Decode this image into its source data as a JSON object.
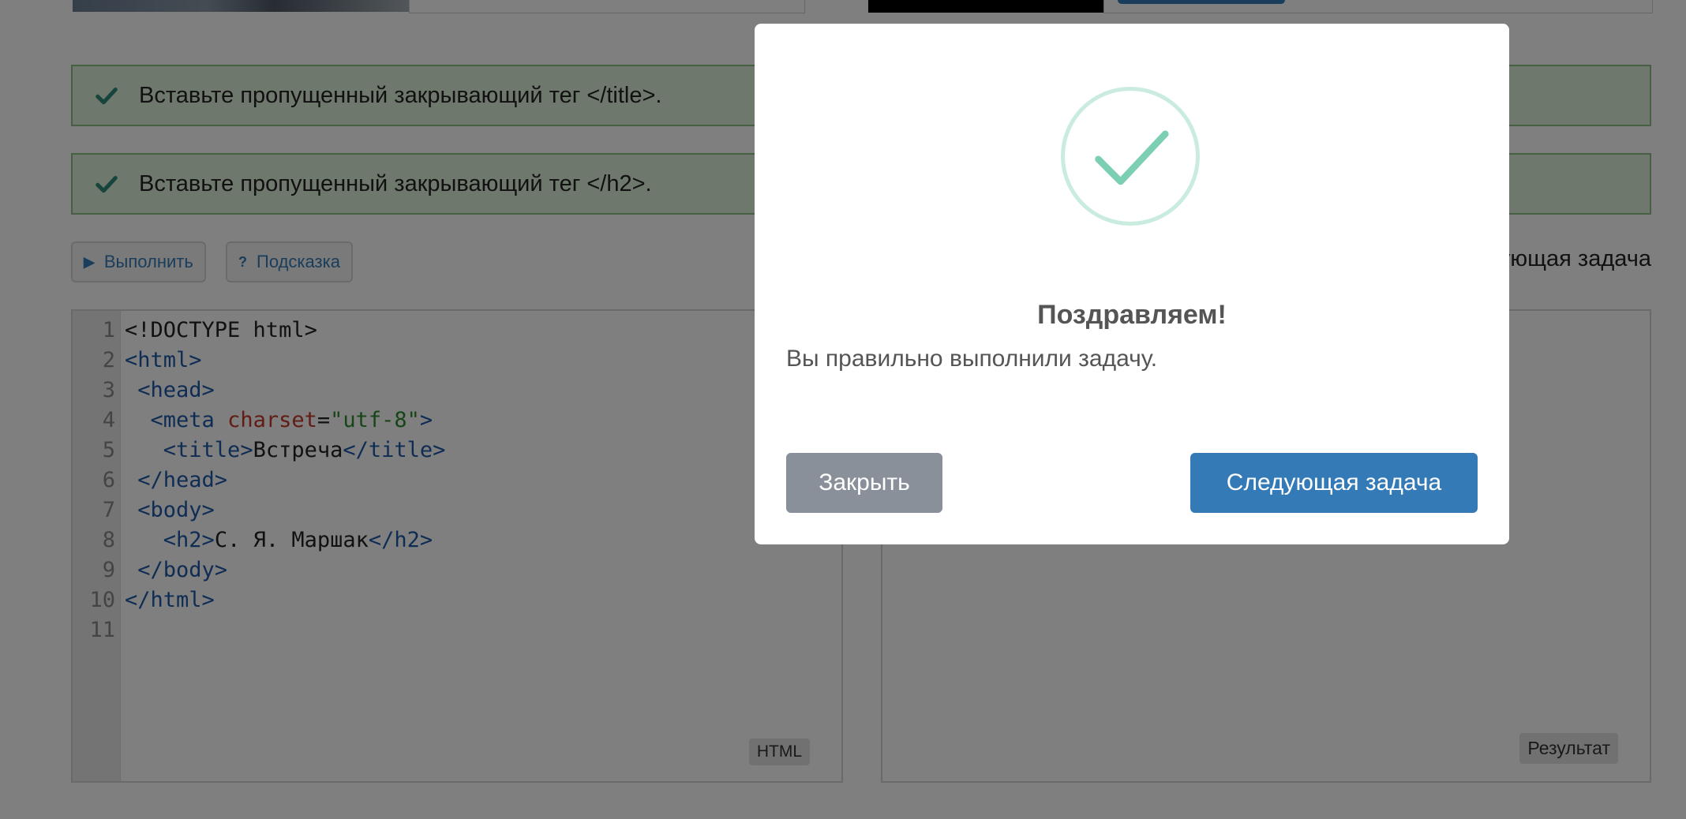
{
  "alerts": [
    {
      "text": "Вставьте пропущенный закрывающий тег </title>."
    },
    {
      "text": "Вставьте пропущенный закрывающий тег </h2>."
    }
  ],
  "toolbar": {
    "run_label": "Выполнить",
    "hint_label": "Подсказка",
    "next_task_label": "Следующая задача"
  },
  "editor": {
    "language": "HTML",
    "line_numbers": [
      "1",
      "2",
      "3",
      "4",
      "5",
      "6",
      "7",
      "8",
      "9",
      "10",
      "11"
    ],
    "lines": [
      "<!DOCTYPE html>",
      "<html>",
      " <head>",
      "  <meta charset=\"utf-8\">",
      "   <title>Встреча</title>",
      " </head>",
      " <body>",
      "   <h2>С. Я. Маршак</h2>",
      " </body>",
      "</html>",
      ""
    ]
  },
  "result": {
    "label": "Результат"
  },
  "modal": {
    "title": "Поздравляем!",
    "message": "Вы правильно выполнили задачу.",
    "close_label": "Закрыть",
    "next_label": "Следующая задача",
    "success_icon": "check-circle-icon"
  },
  "colors": {
    "primary": "#337ab7",
    "success_ring": "#c9ecdf",
    "success_check": "#7ccfb2",
    "alert_bg": "#dff0d8"
  }
}
